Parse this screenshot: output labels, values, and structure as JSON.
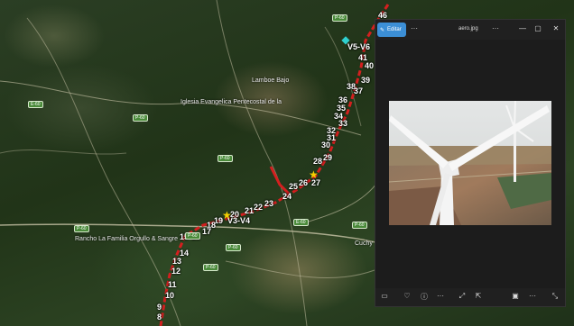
{
  "viewer": {
    "edit_label": "Editar",
    "more_label": "···",
    "filename": "aero.jpg",
    "title_more": "···",
    "minimize": "—",
    "maximize": "▢",
    "close": "✕",
    "bottom_more": "···"
  },
  "map": {
    "km_labels": [
      "46",
      "41",
      "40",
      "39",
      "38",
      "37",
      "36",
      "35",
      "34",
      "33",
      "32",
      "31",
      "30",
      "29",
      "28",
      "27",
      "26",
      "25",
      "24",
      "23",
      "22",
      "21",
      "20",
      "19",
      "18",
      "17",
      "16",
      "15",
      "14",
      "13",
      "12",
      "11",
      "10",
      "9",
      "8"
    ],
    "site_labels": [
      "V5-V6",
      "V3-V4"
    ],
    "places": {
      "rancho": "Rancho La Familia Orgullo & Sangre",
      "iglesia": "Iglesia Evangelica Pentecostal de la",
      "lamboe": "Lamboe Bajo",
      "cuchy": "Cuchy"
    },
    "road_badges": [
      "E-60",
      "P-60",
      "P-60",
      "P-60",
      "P-60",
      "P-60",
      "P-60",
      "E-60",
      "P-60",
      "P-60"
    ]
  },
  "colors": {
    "route": "#d41f1f",
    "edit_button": "#3c8fd6",
    "viewer_bg": "#1c1c1c"
  }
}
